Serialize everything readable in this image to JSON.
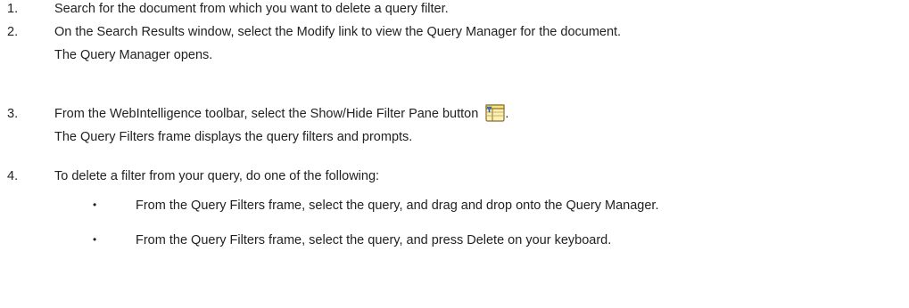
{
  "steps": [
    {
      "number": "1.",
      "lines": [
        "Search for the document from which you want to delete a query filter."
      ]
    },
    {
      "number": "2.",
      "lines": [
        "On the Search Results window, select the Modify link to view the Query Manager for the document.",
        "The Query Manager opens."
      ]
    },
    {
      "number": "3.",
      "line1_before_icon": "From the WebIntelligence toolbar, select the Show/Hide Filter Pane button",
      "line1_after_icon": ".",
      "line2": "The Query Filters frame displays the query filters and prompts.",
      "icon": "show-hide-filter-pane-icon"
    },
    {
      "number": "4.",
      "lines": [
        "To delete a filter from your query, do one of the following:"
      ],
      "bullets": [
        "From the Query Filters frame, select the query, and drag and drop onto the Query Manager.",
        "From the Query Filters frame, select the query, and press Delete on your keyboard."
      ]
    }
  ],
  "bullet_glyph": "•",
  "icon_colors": {
    "frame": "#8a6d2a",
    "fill": "#f7e37a",
    "funnel": "#3a7bd5"
  }
}
